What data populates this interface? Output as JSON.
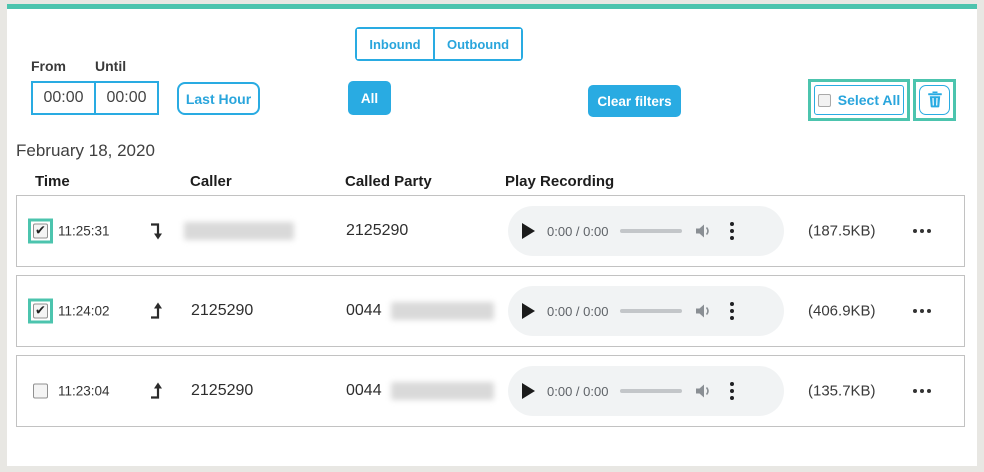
{
  "colors": {
    "teal": "#4cc4ae",
    "blue": "#29abe2",
    "player_bg": "#f1f3f4"
  },
  "filters": {
    "from_label": "From",
    "until_label": "Until",
    "from_value": "00:00",
    "until_value": "00:00",
    "last_hour_label": "Last Hour",
    "tabs": [
      {
        "label": "Inbound"
      },
      {
        "label": "Outbound"
      }
    ],
    "all_label": "All",
    "clear_label": "Clear filters",
    "select_all_label": "Select All",
    "trash_icon": "trash-icon"
  },
  "date_header": "February 18, 2020",
  "table": {
    "columns": [
      "Time",
      "Caller",
      "Called Party",
      "Play Recording"
    ],
    "rows": [
      {
        "checked": true,
        "time": "11:25:31",
        "direction": "inbound",
        "caller": "",
        "caller_redacted": true,
        "called_party": "2125290",
        "called_party_redacted": false,
        "player_time": "0:00 / 0:00",
        "size": "(187.5KB)"
      },
      {
        "checked": true,
        "time": "11:24:02",
        "direction": "outbound",
        "caller": "2125290",
        "caller_redacted": false,
        "called_party": "0044",
        "called_party_redacted": true,
        "player_time": "0:00 / 0:00",
        "size": "(406.9KB)"
      },
      {
        "checked": false,
        "time": "11:23:04",
        "direction": "outbound",
        "caller": "2125290",
        "caller_redacted": false,
        "called_party": "0044",
        "called_party_redacted": true,
        "player_time": "0:00 / 0:00",
        "size": "(135.7KB)"
      }
    ]
  }
}
